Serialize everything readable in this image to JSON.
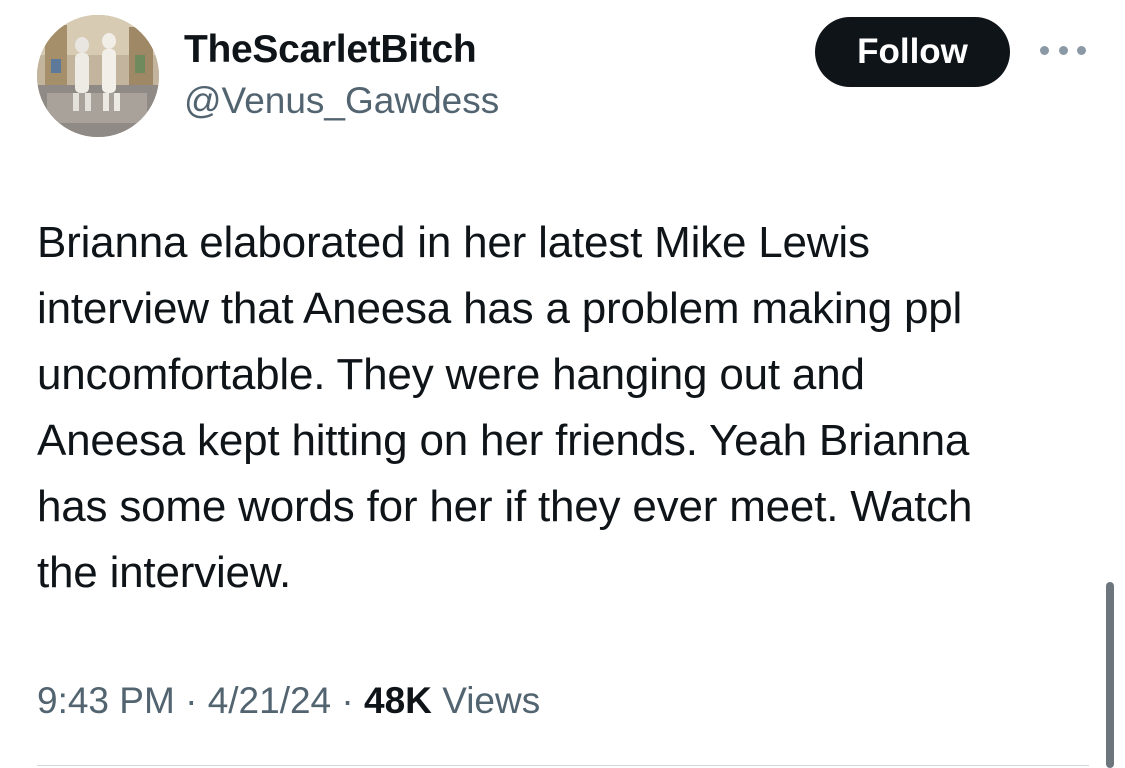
{
  "author": {
    "display_name": "TheScarletBitch",
    "handle": "@Venus_Gawdess",
    "avatar_icon": "profile-photo"
  },
  "actions": {
    "follow_label": "Follow",
    "more_icon": "more-horizontal-icon"
  },
  "tweet": {
    "lines": [
      "Brianna elaborated in her latest Mike Lewis",
      "interview that Aneesa has a problem making ppl",
      "uncomfortable. They were hanging out and",
      "Aneesa kept hitting on her friends. Yeah Brianna",
      "has some words for her if they ever meet. Watch",
      "the interview."
    ]
  },
  "meta": {
    "time": "9:43 PM",
    "separator": " · ",
    "date": "4/21/24",
    "views_count": "48K",
    "views_label": "Views"
  },
  "colors": {
    "text_primary": "#0f1419",
    "text_secondary": "#536471",
    "follow_bg": "#0f1419",
    "follow_text": "#ffffff"
  }
}
